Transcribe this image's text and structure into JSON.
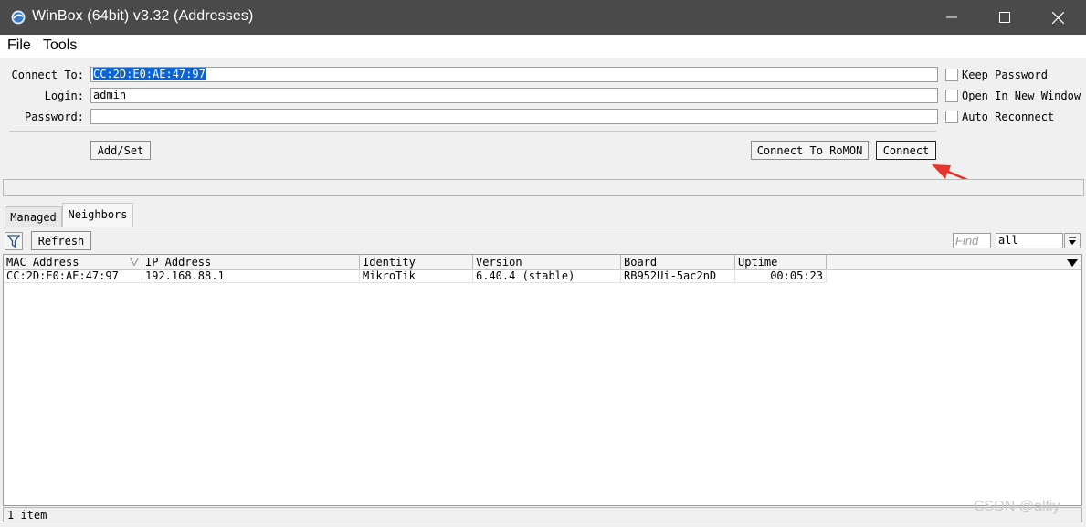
{
  "window": {
    "title": "WinBox (64bit) v3.32 (Addresses)",
    "icon": "winbox-globe-icon",
    "controls": [
      "minimize-icon",
      "maximize-icon",
      "close-icon"
    ]
  },
  "menu": {
    "items": [
      "File",
      "Tools"
    ]
  },
  "connect_form": {
    "connect_to_label": "Connect To:",
    "connect_to_value": "CC:2D:E0:AE:47:97",
    "login_label": "Login:",
    "login_value": "admin",
    "password_label": "Password:",
    "password_value": "",
    "options": [
      {
        "label": "Keep Password",
        "checked": false
      },
      {
        "label": "Open In New Window",
        "checked": false
      },
      {
        "label": "Auto Reconnect",
        "checked": false
      }
    ],
    "add_set_label": "Add/Set",
    "connect_romon_label": "Connect To RoMON",
    "connect_label": "Connect"
  },
  "tabs": [
    {
      "label": "Managed",
      "active": false
    },
    {
      "label": "Neighbors",
      "active": true
    }
  ],
  "toolbar": {
    "filter_icon": "filter-icon",
    "refresh_label": "Refresh",
    "find_placeholder": "Find",
    "scope_value": "all"
  },
  "table": {
    "columns": [
      "MAC Address",
      "IP Address",
      "Identity",
      "Version",
      "Board",
      "Uptime"
    ],
    "rows": [
      {
        "mac": "CC:2D:E0:AE:47:97",
        "ip": "192.168.88.1",
        "identity": "MikroTik",
        "version": "6.40.4 (stable)",
        "board": "RB952Ui-5ac2nD",
        "uptime": "00:05:23"
      }
    ]
  },
  "status": {
    "count_text": "1 item"
  },
  "annotation": {
    "arrow_color": "#e8352b",
    "icon": "red-arrow-icon"
  },
  "watermark": "CSDN @alfiy"
}
